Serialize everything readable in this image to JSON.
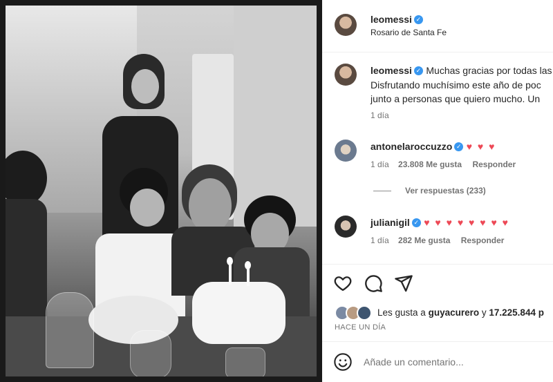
{
  "header": {
    "username": "leomessi",
    "location": "Rosario de Santa Fe"
  },
  "caption": {
    "username": "leomessi",
    "line1": "Muchas gracias por todas las",
    "line2": "Disfrutando muchísimo este año de poc",
    "line3": "junto a personas que quiero mucho. Un",
    "time": "1 día"
  },
  "comments": [
    {
      "username": "antonelaroccuzzo",
      "text": "♥ ♥ ♥",
      "time": "1 día",
      "likes": "23.808 Me gusta",
      "reply": "Responder"
    },
    {
      "username": "julianigil",
      "text": "♥ ♥ ♥ ♥ ♥ ♥ ♥ ♥",
      "time": "1 día",
      "likes": "282 Me gusta",
      "reply": "Responder"
    }
  ],
  "view_replies": "Ver respuestas (233)",
  "likes_line": {
    "prefix": "Les gusta a",
    "user": "guyacurero",
    "middle": "y",
    "count": "17.225.844 p"
  },
  "posted_ago": "HACE UN DÍA",
  "add_comment_placeholder": "Añade un comentario...",
  "icons": {
    "like": "heart-icon",
    "comment": "comment-icon",
    "share": "share-icon",
    "emoji": "emoji-icon",
    "verified": "verified-badge-icon"
  },
  "colors": {
    "verified": "#3897f0",
    "heart": "#ed4956",
    "muted": "#737373"
  }
}
